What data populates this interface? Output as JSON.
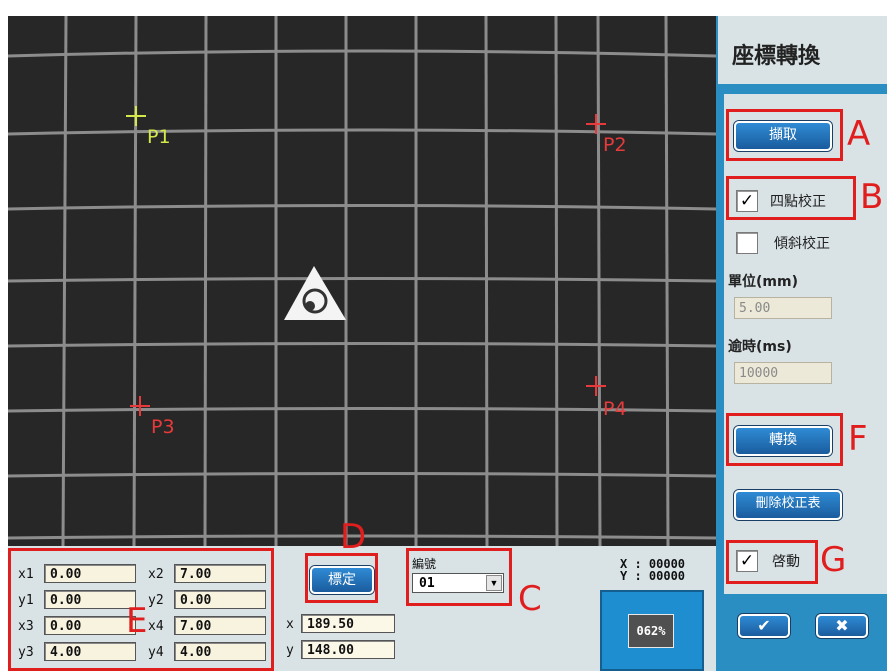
{
  "camera": {
    "points": [
      {
        "label": "P1",
        "color": "#d4e84a"
      },
      {
        "label": "P2",
        "color": "#e83a3a"
      },
      {
        "label": "P3",
        "color": "#e83a3a"
      },
      {
        "label": "P4",
        "color": "#e83a3a"
      }
    ]
  },
  "sidebar": {
    "title": "座標轉換",
    "capture_label": "擷取",
    "four_point_check": "✓",
    "four_point_label": "四點校正",
    "tilt_check": "",
    "tilt_label": "傾斜校正",
    "unit_label": "單位(mm)",
    "unit_value": "5.00",
    "timeout_label": "逾時(ms)",
    "timeout_value": "10000",
    "convert_label": "轉換",
    "delete_label": "刪除校正表",
    "enable_check": "✓",
    "enable_label": "啓動",
    "ok_icon": "✔",
    "cancel_icon": "✖"
  },
  "bottom": {
    "coords": [
      {
        "lbl": "x1",
        "val": "0.00"
      },
      {
        "lbl": "x2",
        "val": "7.00"
      },
      {
        "lbl": "y1",
        "val": "0.00"
      },
      {
        "lbl": "y2",
        "val": "0.00"
      },
      {
        "lbl": "x3",
        "val": "0.00"
      },
      {
        "lbl": "x4",
        "val": "7.00"
      },
      {
        "lbl": "y3",
        "val": "4.00"
      },
      {
        "lbl": "y4",
        "val": "4.00"
      }
    ],
    "calibrate_label": "標定",
    "x_label": "x",
    "x_value": "189.50",
    "y_label": "y",
    "y_value": "148.00",
    "number_label": "編號",
    "number_value": "01",
    "readout_x": "X : 00000",
    "readout_y": "Y : 00000",
    "zoom": "062%"
  },
  "annotations": {
    "A": "A",
    "B": "B",
    "C": "C",
    "D": "D",
    "E": "E",
    "F": "F",
    "G": "G",
    "color": "#e11e1e"
  }
}
